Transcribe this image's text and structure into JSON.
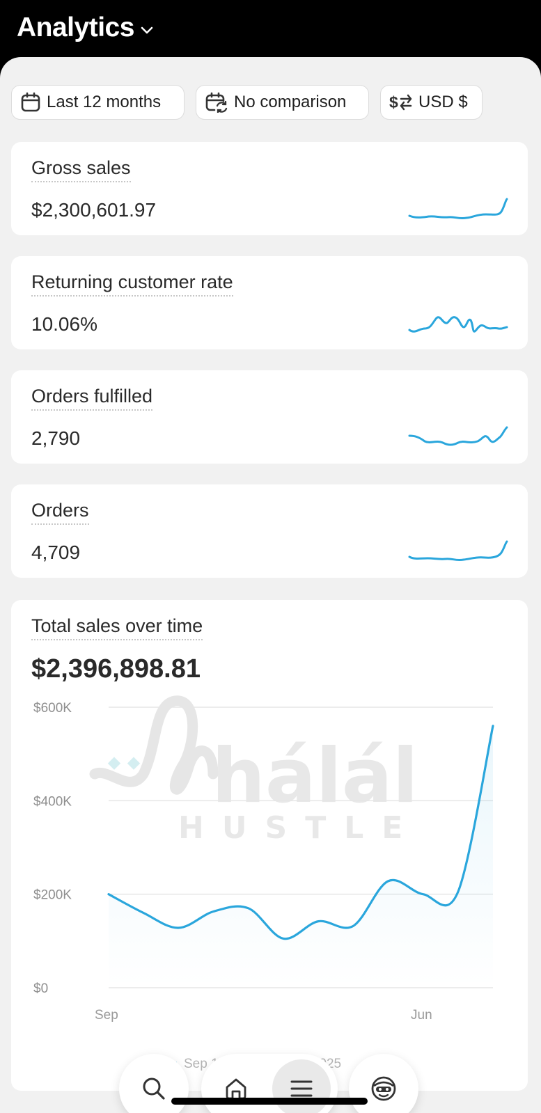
{
  "header": {
    "title": "Analytics"
  },
  "filters": {
    "date_range": "Last 12 months",
    "comparison": "No comparison",
    "currency": "USD $"
  },
  "metrics": [
    {
      "label": "Gross sales",
      "value": "$2,300,601.97"
    },
    {
      "label": "Returning customer rate",
      "value": "10.06%"
    },
    {
      "label": "Orders fulfilled",
      "value": "2,790"
    },
    {
      "label": "Orders",
      "value": "4,709"
    }
  ],
  "total_sales": {
    "label": "Total sales over time",
    "value": "$2,396,898.81",
    "legend": "Sep 1, 2024–Aug 31, 2025"
  },
  "watermark": {
    "line1": "hálál",
    "line2": "HUSTLE"
  },
  "colors": {
    "accent": "#2aa6dc",
    "background": "#f1f1f1"
  },
  "chart_data": {
    "type": "line",
    "title": "Total sales over time",
    "ylim": [
      0,
      600000
    ],
    "y_ticks": [
      "$600K",
      "$400K",
      "$200K",
      "$0"
    ],
    "x_tick_labels": [
      "Sep",
      "Jun"
    ],
    "grid": true,
    "x": [
      "2024-09",
      "2024-10",
      "2024-11",
      "2024-12",
      "2025-01",
      "2025-02",
      "2025-03",
      "2025-04",
      "2025-05",
      "2025-06",
      "2025-07",
      "2025-08"
    ],
    "series": [
      {
        "name": "Sep 1, 2024–Aug 31, 2025",
        "values": [
          200000,
          160000,
          128000,
          163000,
          170000,
          105000,
          142000,
          132000,
          228000,
          200000,
          205000,
          560000
        ]
      }
    ]
  },
  "nav": {
    "search_icon": "search-icon",
    "home_icon": "home-icon",
    "menu_icon": "menu-icon",
    "avatar_icon": "avatar-icon"
  }
}
